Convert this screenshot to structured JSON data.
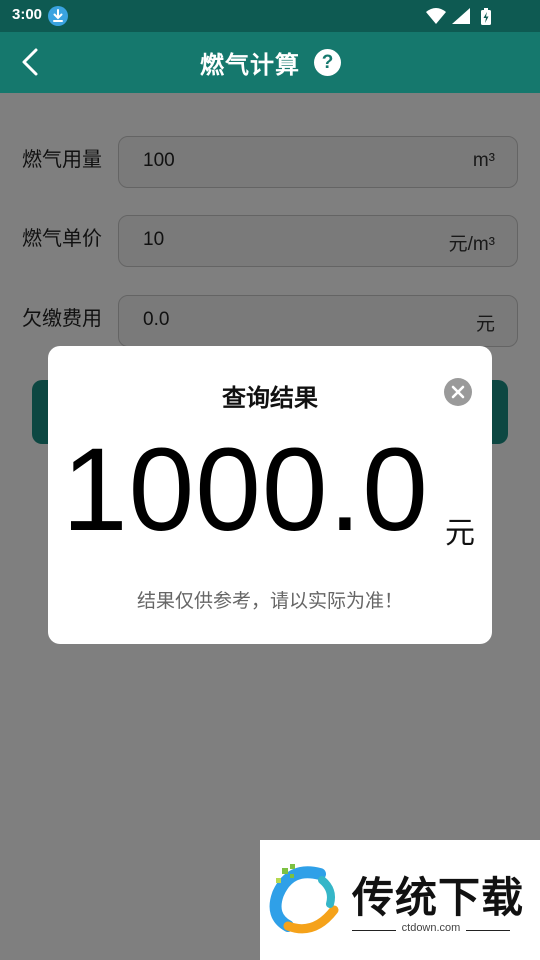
{
  "status_bar": {
    "time": "3:00"
  },
  "header": {
    "title": "燃气计算",
    "help": "?"
  },
  "form": {
    "rows": [
      {
        "label": "燃气用量",
        "value": "100",
        "unit": "m³"
      },
      {
        "label": "燃气单价",
        "value": "10",
        "unit": "元/m³"
      },
      {
        "label": "欠缴费用",
        "value": "0.0",
        "unit": "元"
      }
    ]
  },
  "dialog": {
    "title": "查询结果",
    "value": "1000.0",
    "unit": "元",
    "note": "结果仅供参考，请以实际为准！"
  },
  "watermark": {
    "title": "传统下载",
    "sub": "ctdown.com"
  },
  "colors": {
    "header": "#15786d",
    "status_bar": "#0e5a52",
    "button": "#1a8f84"
  }
}
